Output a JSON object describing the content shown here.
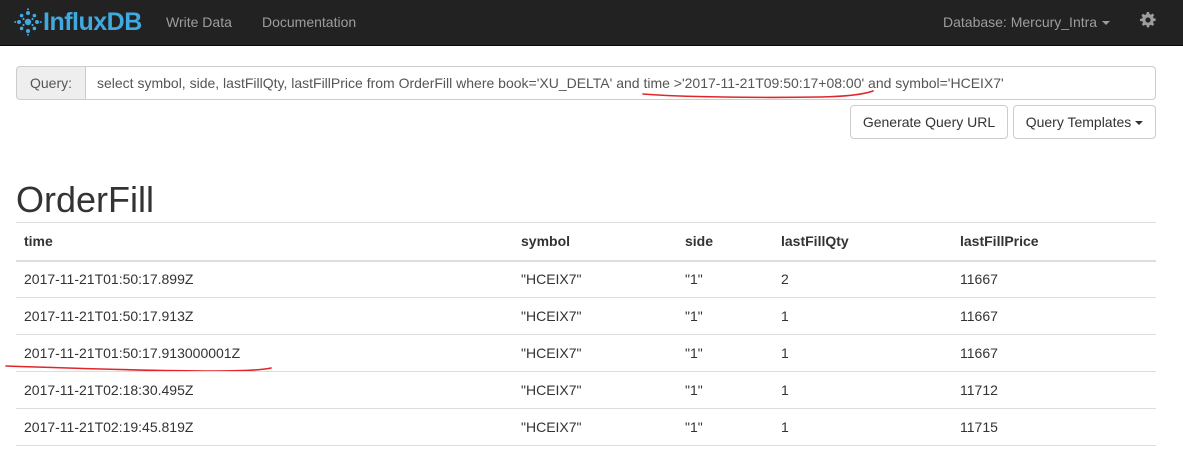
{
  "navbar": {
    "brand": {
      "part1": "Influx",
      "part2": "DB"
    },
    "links": [
      "Write Data",
      "Documentation"
    ],
    "database_label": "Database: Mercury_Intra"
  },
  "query": {
    "addon_label": "Query:",
    "value": "select symbol, side, lastFillQty, lastFillPrice from OrderFill where book='XU_DELTA' and time >'2017-11-21T09:50:17+08:00' and symbol='HCEIX7'"
  },
  "buttons": {
    "generate_url": "Generate Query URL",
    "templates": "Query Templates"
  },
  "series": {
    "name": "OrderFill",
    "columns": [
      "time",
      "symbol",
      "side",
      "lastFillQty",
      "lastFillPrice"
    ],
    "rows": [
      [
        "2017-11-21T01:50:17.899Z",
        "\"HCEIX7\"",
        "\"1\"",
        "2",
        "11667"
      ],
      [
        "2017-11-21T01:50:17.913Z",
        "\"HCEIX7\"",
        "\"1\"",
        "1",
        "11667"
      ],
      [
        "2017-11-21T01:50:17.913000001Z",
        "\"HCEIX7\"",
        "\"1\"",
        "1",
        "11667"
      ],
      [
        "2017-11-21T02:18:30.495Z",
        "\"HCEIX7\"",
        "\"1\"",
        "1",
        "11712"
      ],
      [
        "2017-11-21T02:19:45.819Z",
        "\"HCEIX7\"",
        "\"1\"",
        "1",
        "11715"
      ]
    ]
  },
  "colors": {
    "navbar_bg": "#222222",
    "brand": "#3fa9e0",
    "annotation": "#e0262b"
  },
  "icons": {
    "logo": "influxdb-logo-icon",
    "settings": "gear-icon",
    "dropdown": "caret-down-icon"
  }
}
